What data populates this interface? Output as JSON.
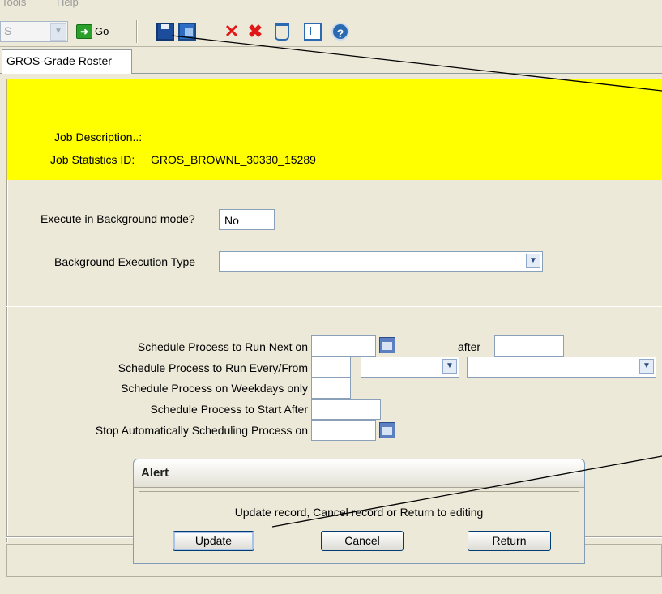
{
  "menubar": {
    "items": [
      "Tools",
      "Help"
    ]
  },
  "toolbar": {
    "combo_value": "S",
    "go_label": "Go",
    "icons": [
      "save-icon",
      "save-and-new-icon",
      "delete-icon",
      "delete-all-icon",
      "clear-icon",
      "form-view-icon",
      "help-icon"
    ]
  },
  "tab": {
    "label": "GROS-Grade Roster"
  },
  "header": {
    "job_description_label": "Job Description..:",
    "job_description_value": "",
    "job_stats_label": "Job Statistics ID:",
    "job_stats_value": "GROS_BROWNL_30330_15289"
  },
  "background": {
    "execute_label": "Execute in Background mode?",
    "execute_value": "No",
    "type_label": "Background Execution Type",
    "type_value": ""
  },
  "schedule": {
    "run_next_label": "Schedule Process to Run Next on",
    "after_label": "after",
    "run_every_label": "Schedule Process to Run Every/From",
    "weekdays_label": "Schedule Process on Weekdays only",
    "start_after_label": "Schedule Process to Start After",
    "stop_label": "Stop Automatically Scheduling Process on"
  },
  "alert": {
    "title": "Alert",
    "message": "Update record, Cancel record or Return to editing",
    "update_label": "Update",
    "cancel_label": "Cancel",
    "return_label": "Return"
  },
  "colors": {
    "header_bg": "#ffff00",
    "window_bg": "#ece9d8",
    "accent": "#2a6ab0"
  }
}
